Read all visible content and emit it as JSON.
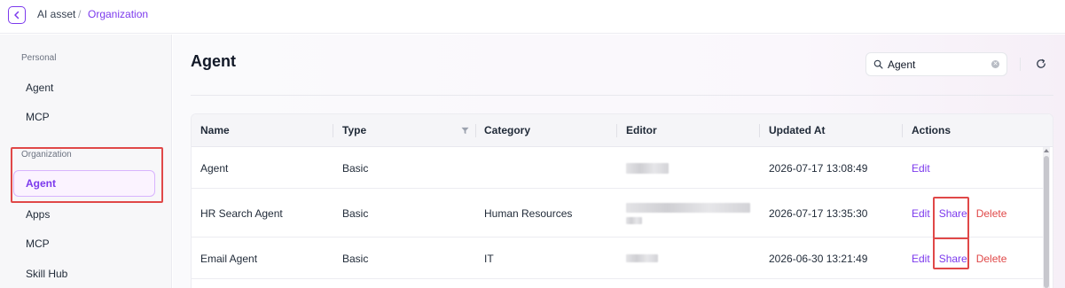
{
  "breadcrumb": {
    "root": "AI asset",
    "separator": "/",
    "current": "Organization"
  },
  "sidebar": {
    "personal_label": "Personal",
    "personal_items": [
      "Agent",
      "MCP"
    ],
    "org_label": "Organization",
    "org_items": [
      "Agent",
      "Apps",
      "MCP",
      "Skill Hub"
    ],
    "active_item": "Agent"
  },
  "main": {
    "title": "Agent",
    "search": {
      "value": "Agent",
      "placeholder": ""
    }
  },
  "table": {
    "columns": [
      "Name",
      "Type",
      "Category",
      "Editor",
      "Updated At",
      "Actions"
    ],
    "rows": [
      {
        "name": "Agent",
        "type": "Basic",
        "category": "",
        "updated_at": "2026-07-17 13:08:49",
        "actions": [
          "Edit"
        ]
      },
      {
        "name": "HR Search Agent",
        "type": "Basic",
        "category": "Human Resources",
        "updated_at": "2026-07-17 13:35:30",
        "actions": [
          "Edit",
          "Share",
          "Delete"
        ]
      },
      {
        "name": "Email Agent",
        "type": "Basic",
        "category": "IT",
        "updated_at": "2026-06-30 13:21:49",
        "actions": [
          "Edit",
          "Share",
          "Delete"
        ]
      }
    ]
  },
  "colors": {
    "accent": "#7c3aed",
    "danger": "#e04848",
    "highlight_border": "#e04848"
  },
  "icons": {
    "back": "chevron-left-icon",
    "search": "search-icon",
    "clear": "clear-icon",
    "refresh": "refresh-icon",
    "filter": "filter-icon"
  }
}
